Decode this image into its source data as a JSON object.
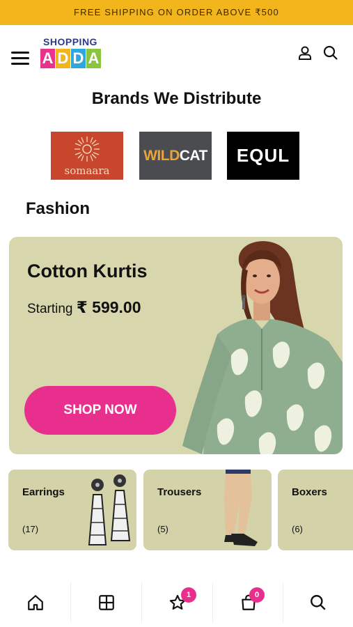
{
  "promo": {
    "text": "FREE SHIPPING ON ORDER ABOVE ₹500"
  },
  "header": {
    "logo_top": "SHOPPING",
    "logo_letters": [
      "A",
      "D",
      "D",
      "A"
    ],
    "logo_tile_colors": [
      "#e8338f",
      "#f2b51c",
      "#2ea7e0",
      "#8bc53f"
    ],
    "icons": [
      "menu-icon",
      "user-icon",
      "search-icon"
    ]
  },
  "brands": {
    "title": "Brands We Distribute",
    "items": [
      {
        "name": "somaara",
        "bg": "#c8472c"
      },
      {
        "wild": "WILD",
        "cat": "CAT",
        "bg": "#4a4c50"
      },
      {
        "name": "EQUL",
        "bg": "#000000"
      }
    ]
  },
  "fashion": {
    "title": "Fashion",
    "hero": {
      "title": "Cotton Kurtis",
      "price_prefix": "Starting",
      "price": "₹ 599.00",
      "button": "SHOP NOW",
      "button_color": "#e82f8e",
      "bg": "#d7d6ad"
    },
    "categories": [
      {
        "name": "Earrings",
        "count": "(17)"
      },
      {
        "name": "Trousers",
        "count": "(5)"
      },
      {
        "name": "Boxers",
        "count": "(6)"
      }
    ]
  },
  "bottom_nav": {
    "items": [
      "home-icon",
      "grid-icon",
      "wishlist-star-icon",
      "cart-bag-icon",
      "search-icon"
    ],
    "wishlist_badge": "1",
    "cart_badge": "0",
    "badge_color": "#e82f8e"
  }
}
